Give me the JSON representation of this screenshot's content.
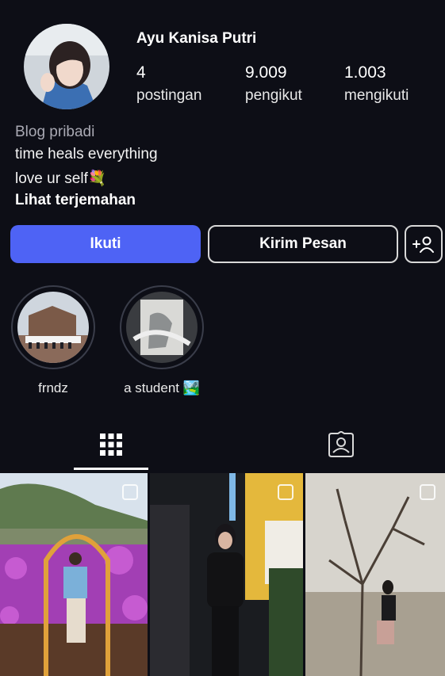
{
  "profile": {
    "name": "Ayu Kanisa Putri",
    "stats": [
      {
        "value": "4",
        "label": "postingan"
      },
      {
        "value": "9.009",
        "label": "pengikut"
      },
      {
        "value": "1.003",
        "label": "mengikuti"
      }
    ],
    "category": "Blog pribadi",
    "bio_lines": [
      "time heals everything",
      "love ur self💐"
    ],
    "translate_link": "Lihat terjemahan"
  },
  "actions": {
    "follow_label": "Ikuti",
    "message_label": "Kirim Pesan",
    "add_user_icon": "add-person-icon"
  },
  "highlights": [
    {
      "label": "frndz"
    },
    {
      "label": "a student 🏞️"
    }
  ],
  "tabs": [
    {
      "icon": "grid-icon",
      "active": true
    },
    {
      "icon": "tagged-person-icon",
      "active": false
    }
  ],
  "colors": {
    "background": "#0d0e16",
    "follow_button": "#4e63f5",
    "muted_text": "#a9a9b3"
  }
}
